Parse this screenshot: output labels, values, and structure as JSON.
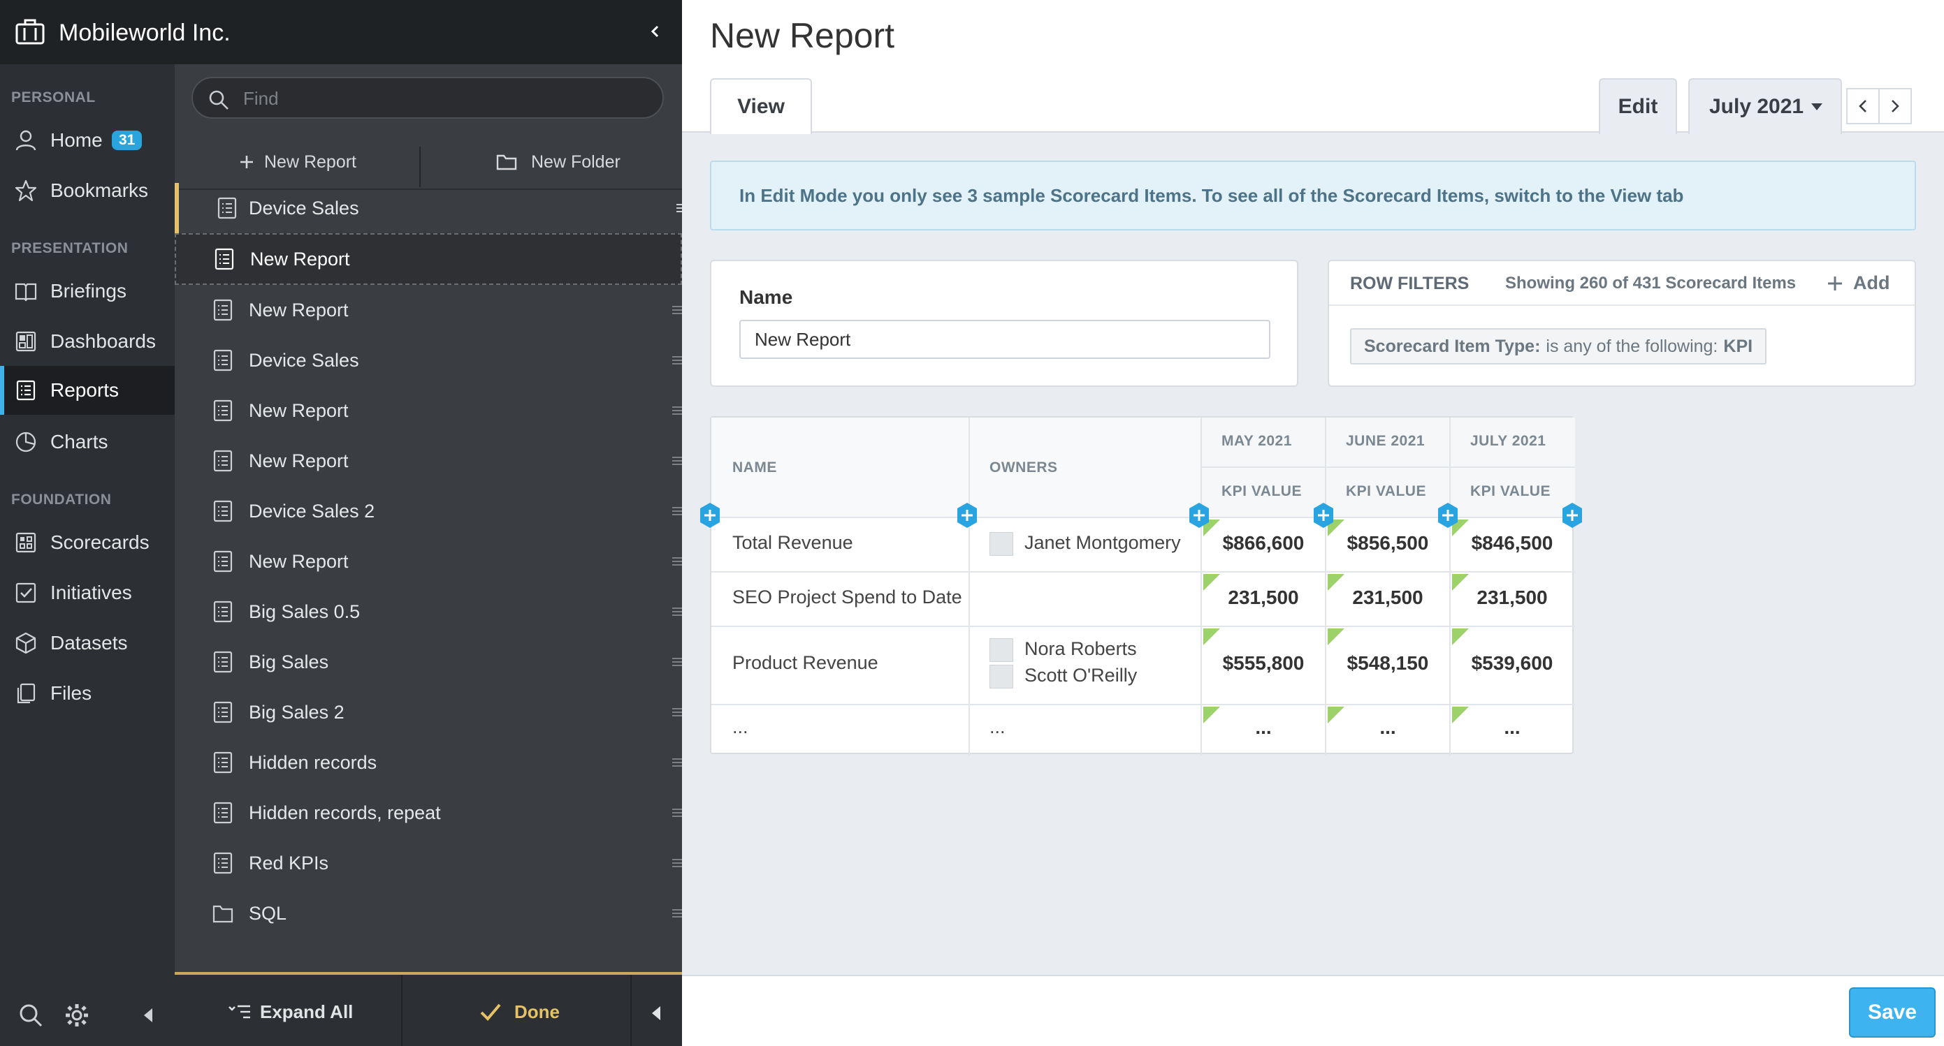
{
  "org": {
    "name": "Mobileworld Inc."
  },
  "nav": {
    "sections": {
      "personal": "PERSONAL",
      "presentation": "PRESENTATION",
      "foundation": "FOUNDATION"
    },
    "items": [
      {
        "label": "Home",
        "icon": "user-icon",
        "badge": "31"
      },
      {
        "label": "Bookmarks",
        "icon": "star-icon"
      },
      {
        "label": "Briefings",
        "icon": "book-icon"
      },
      {
        "label": "Dashboards",
        "icon": "dashboard-icon"
      },
      {
        "label": "Reports",
        "icon": "report-icon",
        "active": true
      },
      {
        "label": "Charts",
        "icon": "pie-chart-icon"
      },
      {
        "label": "Scorecards",
        "icon": "scorecard-icon"
      },
      {
        "label": "Initiatives",
        "icon": "checkbox-icon"
      },
      {
        "label": "Datasets",
        "icon": "cube-icon"
      },
      {
        "label": "Files",
        "icon": "files-icon"
      }
    ]
  },
  "tree": {
    "search_placeholder": "Find",
    "new_report": "New Report",
    "new_folder": "New Folder",
    "items": [
      "Device Sales",
      "New Report",
      "New Report",
      "Device Sales",
      "New Report",
      "New Report",
      "Device Sales 2",
      "New Report",
      "Big Sales 0.5",
      "Big Sales",
      "Big Sales 2",
      "Hidden records",
      "Hidden records, repeat",
      "Red KPIs",
      "SQL"
    ],
    "expand_all": "Expand All",
    "done": "Done"
  },
  "main": {
    "title": "New Report",
    "tab_view": "View",
    "tab_edit": "Edit",
    "period": "July 2021",
    "info": "In Edit Mode you only see 3 sample Scorecard Items. To see all of the Scorecard Items, switch to the View tab",
    "name_label": "Name",
    "name_value": "New Report",
    "row_filters": {
      "title": "ROW FILTERS",
      "showing": "Showing 260 of 431 Scorecard Items",
      "add": "Add",
      "chip_key": "Scorecard Item Type:",
      "chip_mid": "is any of the following:",
      "chip_val": "KPI"
    },
    "table": {
      "col_name": "NAME",
      "col_owners": "OWNERS",
      "months": [
        "MAY 2021",
        "JUNE 2021",
        "JULY 2021"
      ],
      "sub": "KPI VALUE",
      "rows": [
        {
          "name": "Total Revenue",
          "owners": [
            "Janet Montgomery"
          ],
          "values": [
            "$866,600",
            "$856,500",
            "$846,500"
          ]
        },
        {
          "name": "SEO Project Spend to Date",
          "owners": [],
          "values": [
            "231,500",
            "231,500",
            "231,500"
          ]
        },
        {
          "name": "Product Revenue",
          "owners": [
            "Nora Roberts",
            "Scott O'Reilly"
          ],
          "values": [
            "$555,800",
            "$548,150",
            "$539,600"
          ]
        },
        {
          "name": "...",
          "owners": [
            "..."
          ],
          "values": [
            "...",
            "...",
            "..."
          ]
        }
      ]
    },
    "save": "Save"
  },
  "colors": {
    "accent": "#3db4ef",
    "nav_bg": "#2c2f33",
    "tree_bg": "#3a3d42",
    "flag": "#9dd16a",
    "folder_accent": "#e6c266"
  }
}
